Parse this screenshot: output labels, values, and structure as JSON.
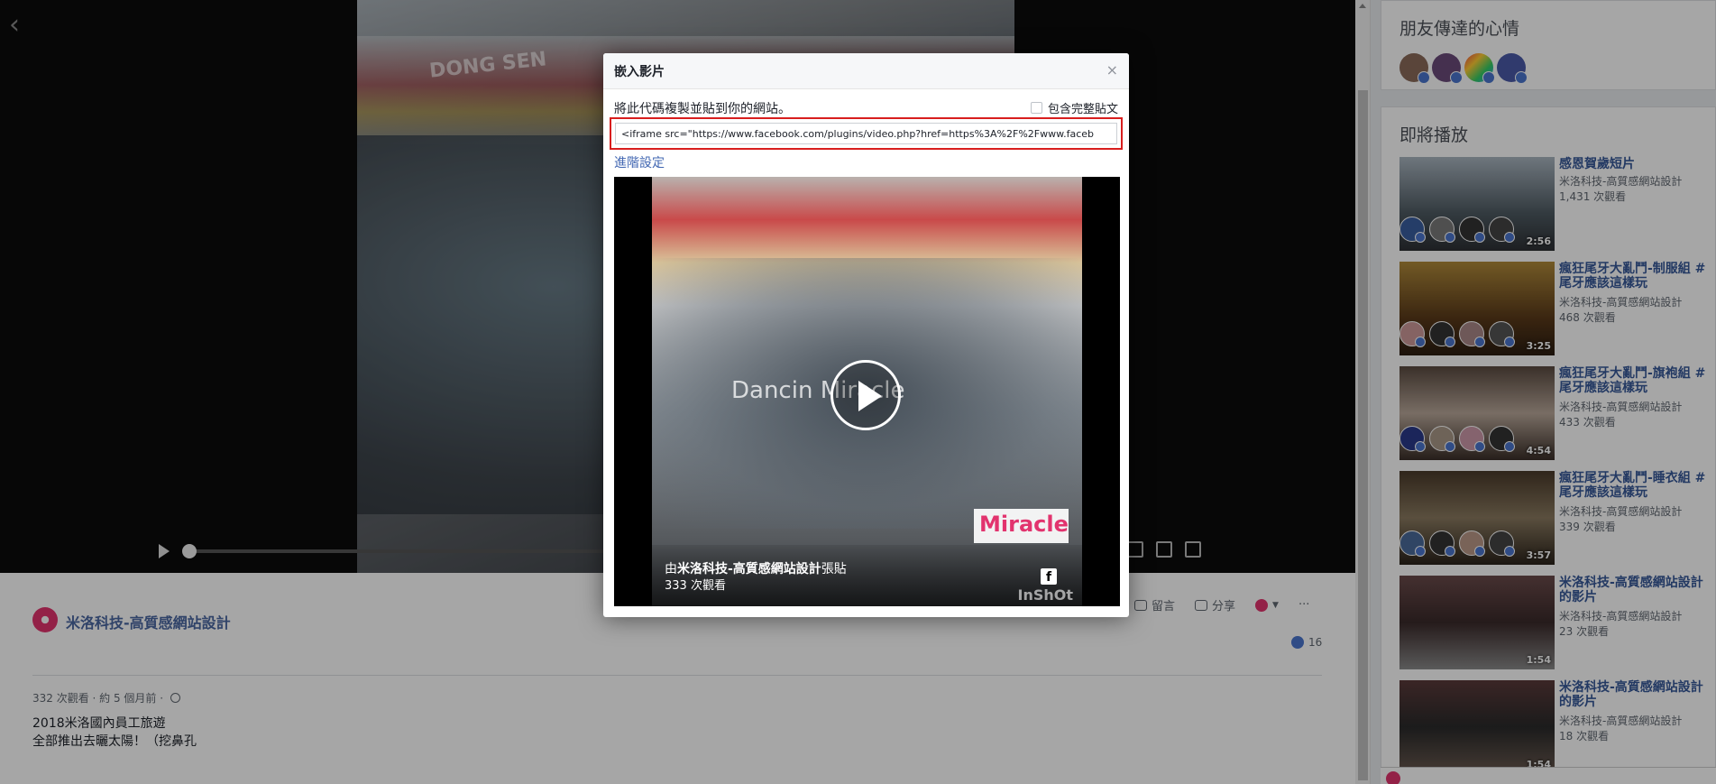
{
  "player": {
    "boat_text": "DONG SEN",
    "back_icon": "chevron-left-icon"
  },
  "page": {
    "name": "米洛科技-高質感網站設計",
    "actions": {
      "comment": "留言",
      "share": "分享",
      "more": "···"
    },
    "likes": "16",
    "meta": "332 次觀看 · 約 5 個月前 ·",
    "description_line1": "2018米洛國內員工旅遊",
    "description_line2": "全部推出去曬太陽！（挖鼻孔"
  },
  "sidebar": {
    "friends_title": "朋友傳達的心情",
    "upnext_title": "即將播放",
    "videos": [
      {
        "title": "感恩賀歲短片",
        "channel": "米洛科技-高質感網站設計",
        "views": "1,431 次觀看",
        "duration": "2:56"
      },
      {
        "title": "瘋狂尾牙大亂鬥-制服組 #尾牙應該這樣玩",
        "channel": "米洛科技-高質感網站設計",
        "views": "468 次觀看",
        "duration": "3:25"
      },
      {
        "title": "瘋狂尾牙大亂鬥-旗袍組 #尾牙應該這樣玩",
        "channel": "米洛科技-高質感網站設計",
        "views": "433 次觀看",
        "duration": "4:54"
      },
      {
        "title": "瘋狂尾牙大亂鬥-睡衣組 #尾牙應該這樣玩",
        "channel": "米洛科技-高質感網站設計",
        "views": "339 次觀看",
        "duration": "3:57"
      },
      {
        "title": "米洛科技-高質感網站設計的影片",
        "channel": "米洛科技-高質感網站設計",
        "views": "23 次觀看",
        "duration": "1:54"
      },
      {
        "title": "米洛科技-高質感網站設計的影片",
        "channel": "米洛科技-高質感網站設計",
        "views": "18 次觀看",
        "duration": "1:54"
      }
    ]
  },
  "modal": {
    "title": "嵌入影片",
    "close": "×",
    "instruction": "將此代碼複製並貼到你的網站。",
    "include_full_post": "包含完整貼文",
    "embed_code": "<iframe src=\"https://www.facebook.com/plugins/video.php?href=https%3A%2F%2Fwww.faceb",
    "advanced_settings": "進階設定",
    "preview": {
      "watermark": "Dancin Miracle",
      "badge": "Miracle",
      "posted_by_prefix": "由",
      "posted_by_name": "米洛科技-高質感網站設計",
      "posted_by_suffix": "張貼",
      "views": "333 次觀看",
      "fb_glyph": "f",
      "brand": "InShOt"
    }
  },
  "colors": {
    "link": "#365899",
    "accent": "#4267b2",
    "highlight_border": "#d81e1e",
    "brand_pink": "#e2336e"
  }
}
